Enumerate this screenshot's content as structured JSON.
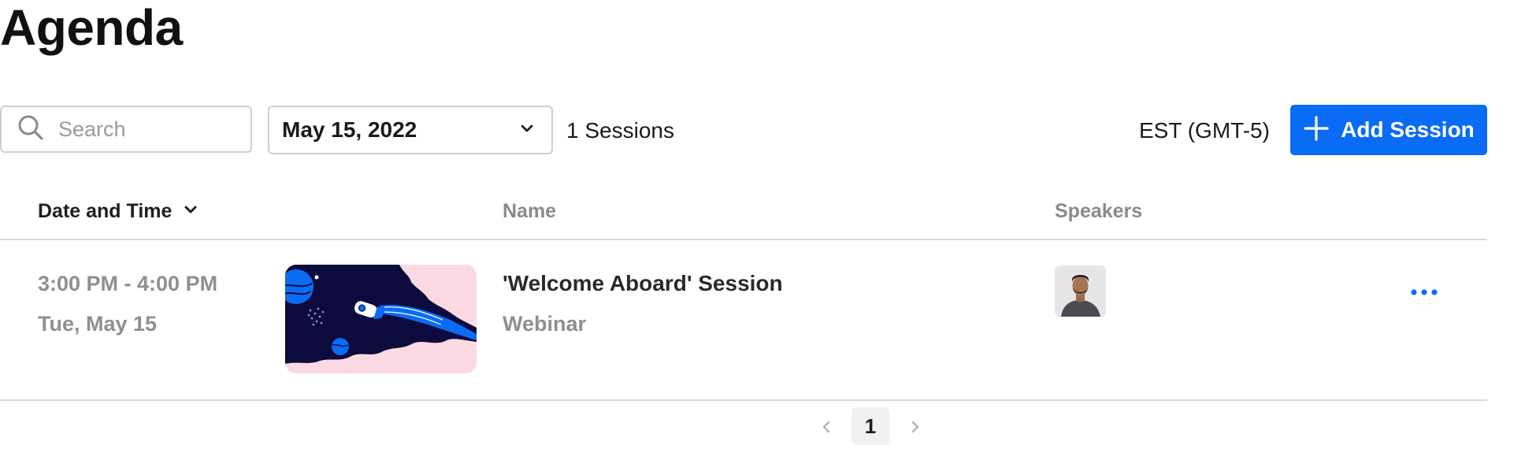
{
  "page": {
    "title": "Agenda"
  },
  "toolbar": {
    "search_placeholder": "Search",
    "search_value": "",
    "date_select_value": "May 15, 2022",
    "sessions_count": "1 Sessions",
    "timezone": "EST (GMT-5)",
    "add_session_label": "Add Session"
  },
  "table": {
    "columns": {
      "date_time": "Date and Time",
      "name": "Name",
      "speakers": "Speakers"
    },
    "rows": [
      {
        "time": "3:00 PM - 4:00 PM",
        "date": "Tue, May 15",
        "name": "'Welcome Aboard' Session",
        "type": "Webinar"
      }
    ]
  },
  "pagination": {
    "current_page": "1"
  },
  "icons": {
    "search": "search-icon",
    "date_dropdown": "chevron-down-icon",
    "add": "plus-icon",
    "sort": "chevron-down-icon",
    "more": "more-horizontal-icon",
    "prev": "chevron-left-icon",
    "next": "chevron-right-icon"
  },
  "colors": {
    "accent": "#0a6cf5",
    "thumbnail_background": "#fbd9e3",
    "thumbnail_ink": "#0d0b3d"
  }
}
